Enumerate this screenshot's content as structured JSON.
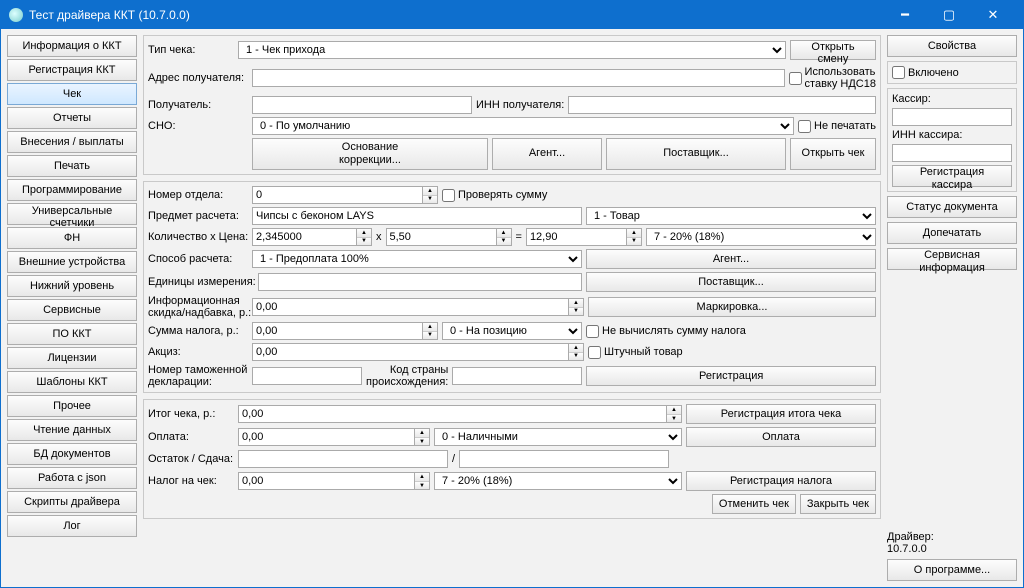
{
  "title": "Тест драйвера ККТ (10.7.0.0)",
  "nav": [
    "Информация о ККТ",
    "Регистрация ККТ",
    "Чек",
    "Отчеты",
    "Внесения / выплаты",
    "Печать",
    "Программирование",
    "Универсальные счетчики",
    "ФН",
    "Внешние устройства",
    "Нижний уровень",
    "Сервисные",
    "ПО ККТ",
    "Лицензии",
    "Шаблоны ККТ",
    "Прочее",
    "Чтение данных",
    "БД документов",
    "Работа с json",
    "Скрипты драйвера",
    "Лог"
  ],
  "nav_active": "Чек",
  "top": {
    "check_type_lbl": "Тип чека:",
    "check_type_val": "1 - Чек прихода",
    "open_shift": "Открыть смену",
    "recipient_addr_lbl": "Адрес получателя:",
    "recipient_addr_val": "",
    "use_rate_line1": "Использовать",
    "use_rate_line2": "ставку НДС18",
    "recipient_lbl": "Получатель:",
    "recipient_val": "",
    "inn_recipient_lbl": "ИНН получателя:",
    "inn_recipient_val": "",
    "sno_lbl": "СНО:",
    "sno_val": "0 - По умолчанию",
    "no_print": "Не печатать",
    "correction_basis_line1": "Основание",
    "correction_basis_line2": "коррекции...",
    "agent_btn": "Агент...",
    "supplier_btn": "Поставщик...",
    "open_check": "Открыть чек"
  },
  "mid": {
    "dept_lbl": "Номер отдела:",
    "dept_val": "0",
    "check_sum": "Проверять сумму",
    "item_lbl": "Предмет расчета:",
    "item_val": "Чипсы с беконом LAYS",
    "item_type": "1 - Товар",
    "qty_price_lbl": "Количество x Цена:",
    "qty_val": "2,345000",
    "mult": "x",
    "price_val": "5,50",
    "eq": "=",
    "total_val": "12,90",
    "tax_sel": "7 - 20% (18%)",
    "pay_method_lbl": "Способ расчета:",
    "pay_method_val": "1 - Предоплата 100%",
    "agent_btn": "Агент...",
    "units_lbl": "Единицы измерения:",
    "units_val": "",
    "supplier_btn": "Поставщик...",
    "info_discount_line1": "Информационная",
    "info_discount_line2": "скидка/надбавка, р.:",
    "info_discount_val": "0,00",
    "marking_btn": "Маркировка...",
    "tax_sum_lbl": "Сумма налога, р.:",
    "tax_sum_val": "0,00",
    "tax_pos": "0 - На позицию",
    "no_calc_tax": "Не вычислять сумму налога",
    "excise_lbl": "Акциз:",
    "excise_val": "0,00",
    "piece_goods": "Штучный товар",
    "customs_lbl_line1": "Номер таможенной",
    "customs_lbl_line2": "декларации:",
    "customs_val": "",
    "country_lbl_line1": "Код страны",
    "country_lbl_line2": "происхождения:",
    "country_val": "",
    "registration_btn": "Регистрация"
  },
  "bot": {
    "check_total_lbl": "Итог чека, р.:",
    "check_total_val": "0,00",
    "reg_total_btn": "Регистрация итога чека",
    "payment_lbl": "Оплата:",
    "payment_val": "0,00",
    "payment_type": "0 - Наличными",
    "pay_btn": "Оплата",
    "remainder_lbl": "Остаток / Сдача:",
    "remainder_val1": "",
    "remainder_val2": "",
    "slash": "/",
    "tax_check_lbl": "Налог на чек:",
    "tax_check_val": "0,00",
    "tax_check_sel": "7 - 20% (18%)",
    "reg_tax_btn": "Регистрация налога",
    "cancel_check": "Отменить чек",
    "close_check": "Закрыть чек"
  },
  "right": {
    "properties": "Свойства",
    "enabled": "Включено",
    "cashier_lbl": "Кассир:",
    "cashier_val": "",
    "cashier_inn_lbl": "ИНН кассира:",
    "cashier_inn_val": "",
    "reg_cashier_line1": "Регистрация",
    "reg_cashier_line2": "кассира",
    "doc_status": "Статус документа",
    "reprint": "Допечатать",
    "service_info_line1": "Сервисная",
    "service_info_line2": "информация",
    "driver_lbl": "Драйвер:",
    "driver_ver": "10.7.0.0",
    "about": "О программе..."
  }
}
